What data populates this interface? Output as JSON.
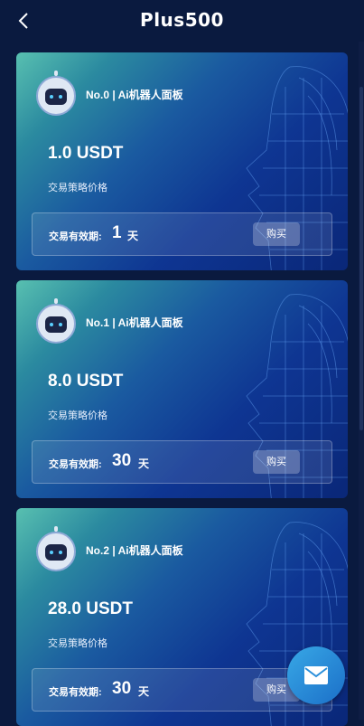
{
  "header": {
    "title": "Plus500",
    "back_icon": "chevron-left-icon"
  },
  "cards": [
    {
      "title": "No.0 | Ai机器人面板",
      "price": "1.0 USDT",
      "price_label": "交易策略价格",
      "validity_label": "交易有效期:",
      "validity_value": "1",
      "validity_unit": "天",
      "buy_label": "购买"
    },
    {
      "title": "No.1 | Ai机器人面板",
      "price": "8.0 USDT",
      "price_label": "交易策略价格",
      "validity_label": "交易有效期:",
      "validity_value": "30",
      "validity_unit": "天",
      "buy_label": "购买"
    },
    {
      "title": "No.2 | Ai机器人面板",
      "price": "28.0 USDT",
      "price_label": "交易策略价格",
      "validity_label": "交易有效期:",
      "validity_value": "30",
      "validity_unit": "天",
      "buy_label": "购买"
    }
  ],
  "fab": {
    "icon": "mail-icon"
  },
  "colors": {
    "background": "#0a1a3f",
    "card_gradient_start": "#58c0b0",
    "card_gradient_end": "#0a2778",
    "fab": "#2a8fda"
  }
}
